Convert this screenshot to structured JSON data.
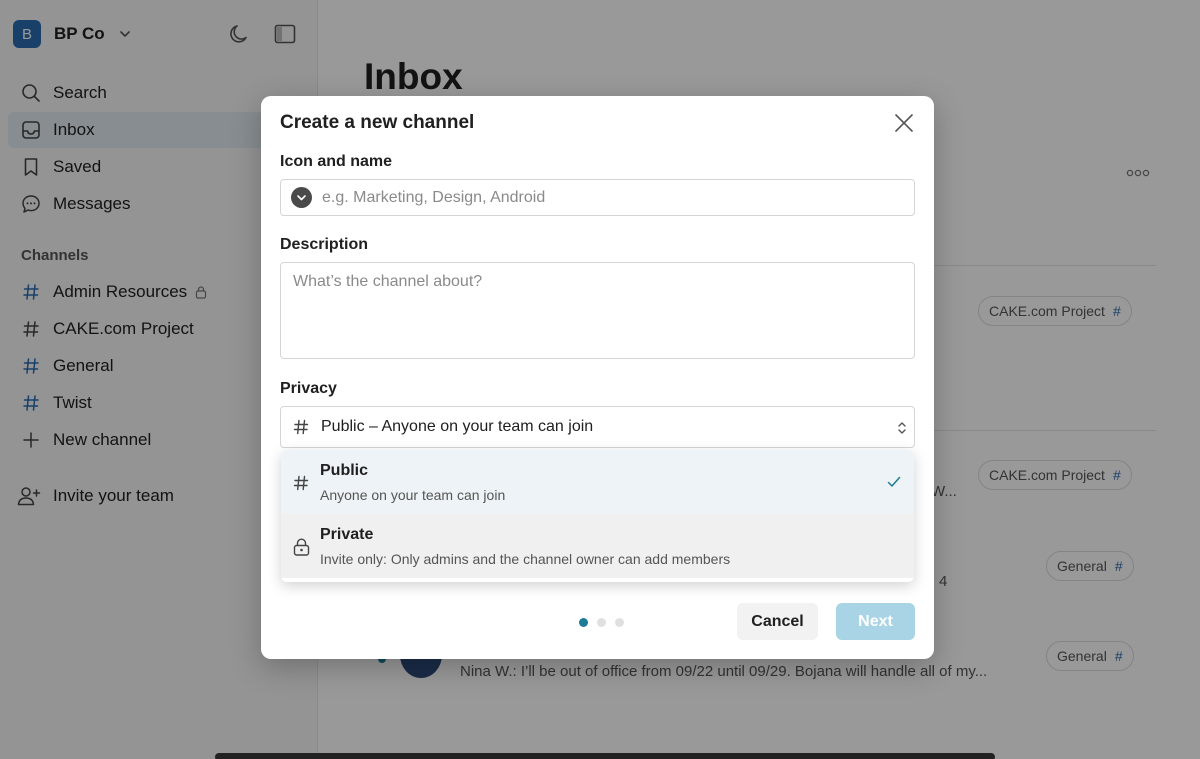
{
  "workspace": {
    "initial": "B",
    "name": "BP Co"
  },
  "sidebar": {
    "nav": [
      {
        "label": "Search",
        "icon": "search-icon"
      },
      {
        "label": "Inbox",
        "icon": "inbox-icon",
        "active": true
      },
      {
        "label": "Saved",
        "icon": "bookmark-icon"
      },
      {
        "label": "Messages",
        "icon": "chat-bubble-icon"
      }
    ],
    "channels_label": "Channels",
    "channels": [
      {
        "label": "Admin Resources",
        "private": true
      },
      {
        "label": "CAKE.com Project"
      },
      {
        "label": "General"
      },
      {
        "label": "Twist"
      }
    ],
    "new_channel_label": "New channel",
    "invite_label": "Invite your team"
  },
  "main": {
    "title": "Inbox",
    "threads": [
      {
        "tag": "CAKE.com Project",
        "preview": ""
      },
      {
        "tag": "CAKE.com Project",
        "preview": "W..."
      },
      {
        "tag": "General",
        "preview": "4"
      },
      {
        "tag": "General",
        "preview": "Nina W.: I’ll be out of office from 09/22 until 09/29. Bojana will handle all of my..."
      }
    ],
    "tag_hash": "#"
  },
  "modal": {
    "title": "Create a new channel",
    "icon_name_label": "Icon and name",
    "name_placeholder": "e.g. Marketing, Design, Android",
    "name_value": "",
    "description_label": "Description",
    "description_placeholder": "What’s the channel about?",
    "privacy_label": "Privacy",
    "privacy_selected": "Public – Anyone on your team can join",
    "privacy_options": [
      {
        "title": "Public",
        "description": "Anyone on your team can join",
        "icon": "hash-icon",
        "selected": true
      },
      {
        "title": "Private",
        "description": "Invite only: Only admins and the channel owner can add members",
        "icon": "lock-icon",
        "selected": false
      }
    ],
    "pager": {
      "total": 3,
      "current": 1
    },
    "cancel_label": "Cancel",
    "next_label": "Next"
  },
  "colors": {
    "accent": "#1f7a96",
    "brand": "#2b6cb0",
    "next_disabled": "#a9d4e6",
    "selected_row": "#edf3f6"
  }
}
